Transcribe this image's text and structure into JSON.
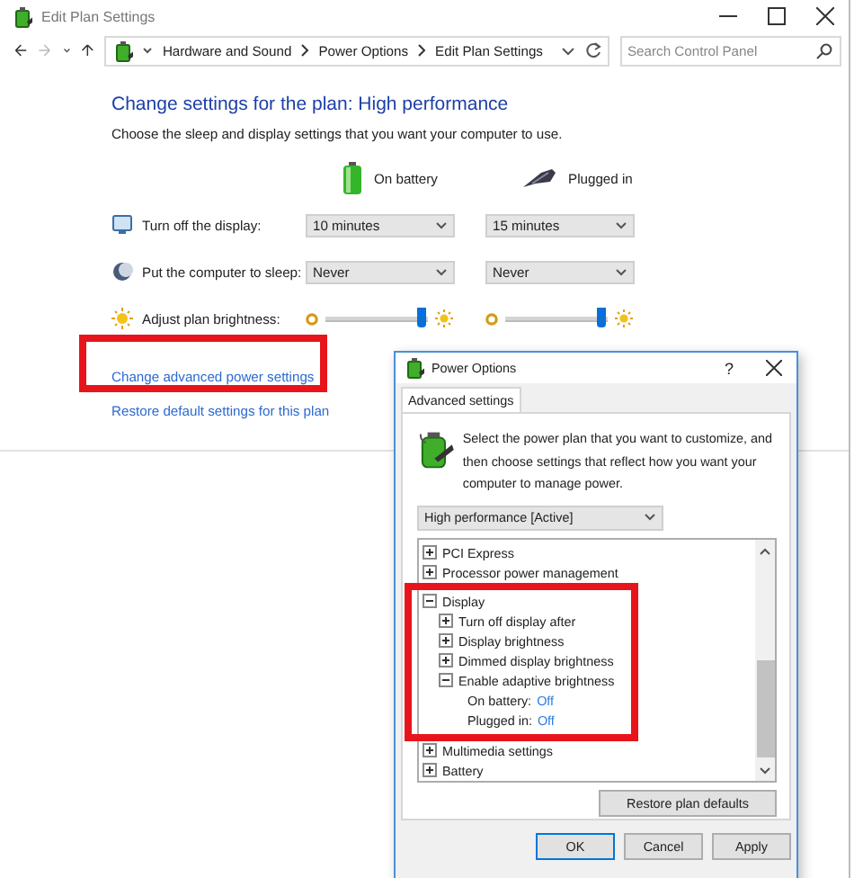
{
  "window": {
    "title": "Edit Plan Settings"
  },
  "address_bar": {
    "breadcrumb": [
      "Hardware and Sound",
      "Power Options",
      "Edit Plan Settings"
    ]
  },
  "search": {
    "placeholder": "Search Control Panel"
  },
  "plan": {
    "heading": "Change settings for the plan: High performance",
    "description": "Choose the sleep and display settings that you want your computer to use.",
    "columns": [
      "On battery",
      "Plugged in"
    ],
    "settings": [
      {
        "kind": "dropdown",
        "label": "Turn off the display:",
        "values": [
          "10 minutes",
          "15 minutes"
        ]
      },
      {
        "kind": "dropdown",
        "label": "Put the computer to sleep:",
        "values": [
          "Never",
          "Never"
        ]
      },
      {
        "kind": "slider",
        "label": "Adjust plan brightness:",
        "sliders": [
          {
            "level": 0.95
          },
          {
            "level": 0.95
          }
        ]
      }
    ]
  },
  "links": [
    {
      "text": "Change advanced power settings",
      "highlighted": true
    },
    {
      "text": "Restore default settings for this plan",
      "highlighted": false
    }
  ],
  "dialog": {
    "title": "Power Options",
    "help": "?",
    "tabs": [
      {
        "label": "Advanced settings",
        "selected": true
      }
    ],
    "intro": "Select the power plan that you want to customize, and then choose settings that reflect how you want your computer to manage power.",
    "plan_select": "High performance [Active]",
    "tree": [
      {
        "kind": "group",
        "label": "PCI Express",
        "expanded": false,
        "highlighted": false
      },
      {
        "kind": "group",
        "label": "Processor power management",
        "expanded": false,
        "highlighted": false
      },
      {
        "kind": "group",
        "label": "Display",
        "expanded": true,
        "highlighted": true,
        "children": [
          {
            "kind": "group",
            "label": "Turn off display after",
            "expanded": false,
            "highlighted": false
          },
          {
            "kind": "group",
            "label": "Display brightness",
            "expanded": false,
            "highlighted": false
          },
          {
            "kind": "group",
            "label": "Dimmed display brightness",
            "expanded": false,
            "highlighted": false
          },
          {
            "kind": "group",
            "label": "Enable adaptive brightness",
            "expanded": true,
            "highlighted": false,
            "children": [
              {
                "kind": "setting",
                "label": "On battery:",
                "value": "Off"
              },
              {
                "kind": "setting",
                "label": "Plugged in:",
                "value": "Off"
              }
            ]
          }
        ]
      },
      {
        "kind": "group",
        "label": "Multimedia settings",
        "expanded": false,
        "highlighted": false
      },
      {
        "kind": "group",
        "label": "Battery",
        "expanded": false,
        "highlighted": false
      }
    ],
    "restore_button": "Restore plan defaults",
    "buttons": [
      {
        "label": "OK",
        "default": true
      },
      {
        "label": "Cancel",
        "default": false
      },
      {
        "label": "Apply",
        "default": false
      }
    ]
  }
}
